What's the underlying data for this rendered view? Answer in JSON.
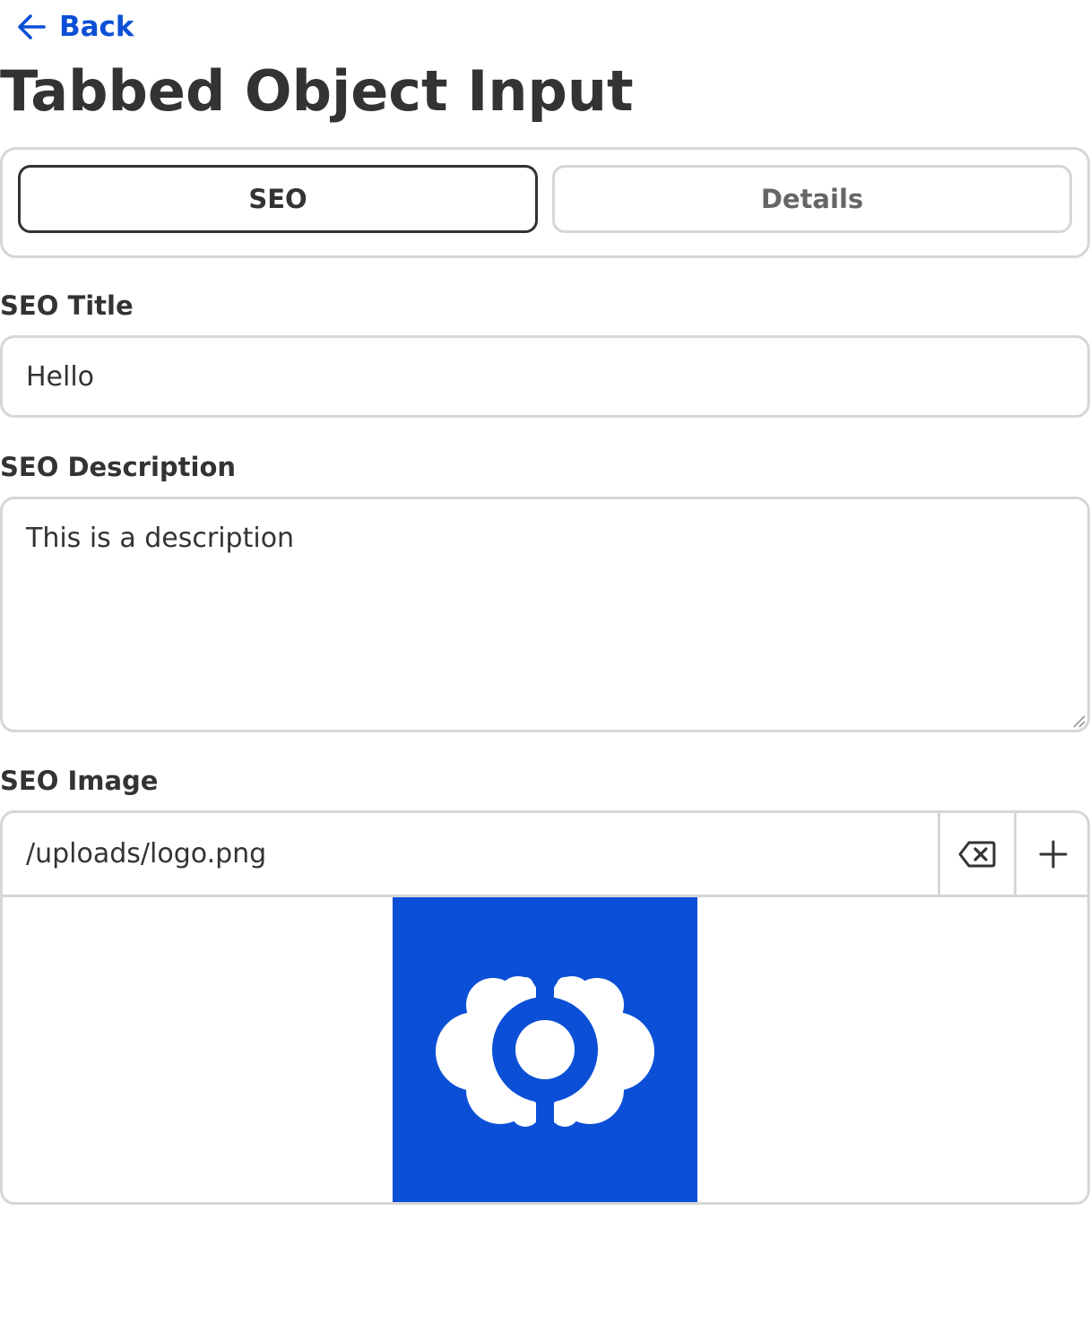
{
  "nav": {
    "back_label": "Back",
    "back_icon": "arrow-left-icon"
  },
  "page": {
    "title": "Tabbed Object Input"
  },
  "tabs": [
    {
      "label": "SEO",
      "active": true
    },
    {
      "label": "Details",
      "active": false
    }
  ],
  "fields": {
    "seo_title": {
      "label": "SEO Title",
      "value": "Hello"
    },
    "seo_description": {
      "label": "SEO Description",
      "value": "This is a description"
    },
    "seo_image": {
      "label": "SEO Image",
      "value": "/uploads/logo.png",
      "clear_icon": "backspace-icon",
      "add_icon": "plus-icon"
    }
  },
  "colors": {
    "accent": "#0b4fd6",
    "logo_background": "#0a4fd6",
    "text": "#333333",
    "border": "#d6d6d6"
  }
}
